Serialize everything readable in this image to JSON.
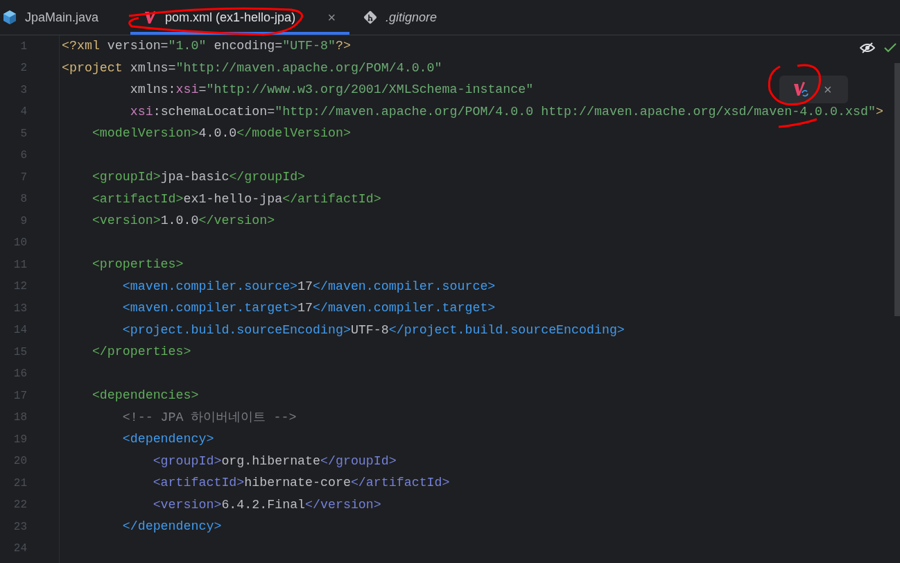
{
  "tabs": [
    {
      "label": "JpaMain.java",
      "kind": "java",
      "selected": false
    },
    {
      "label": "pom.xml (ex1-hello-jpa)",
      "kind": "maven",
      "selected": true,
      "close": "×"
    },
    {
      "label": ".gitignore",
      "kind": "git",
      "selected": false
    }
  ],
  "popup": {
    "close": "×"
  },
  "lines": [
    {
      "number": "1",
      "tokens": [
        {
          "kind": "tag1",
          "t": "<?xml"
        },
        {
          "kind": "attr",
          "t": " version="
        },
        {
          "kind": "str",
          "t": "\"1.0\""
        },
        {
          "kind": "attr",
          "t": " encoding="
        },
        {
          "kind": "str",
          "t": "\"UTF-8\""
        },
        {
          "kind": "tag1",
          "t": "?>"
        }
      ]
    },
    {
      "number": "2",
      "tokens": [
        {
          "kind": "tag1",
          "t": "<project"
        },
        {
          "kind": "attr",
          "t": " xmlns="
        },
        {
          "kind": "str",
          "t": "\"http://maven.apache.org/POM/4.0.0\""
        }
      ]
    },
    {
      "number": "3",
      "tokens": [
        {
          "kind": "attr",
          "t": "         xmlns:"
        },
        {
          "kind": "ns",
          "t": "xsi"
        },
        {
          "kind": "attr",
          "t": "="
        },
        {
          "kind": "str",
          "t": "\"http://www.w3.org/2001/XMLSchema-instance\""
        }
      ]
    },
    {
      "number": "4",
      "tokens": [
        {
          "kind": "ns",
          "t": "         xsi"
        },
        {
          "kind": "attr",
          "t": ":schemaLocation="
        },
        {
          "kind": "str",
          "t": "\"http://maven.apache.org/POM/4.0.0 http://maven.apache.org/xsd/maven-4.0.0.xsd\""
        },
        {
          "kind": "tag1",
          "t": ">"
        }
      ]
    },
    {
      "number": "5",
      "tokens": [
        {
          "kind": "tag2",
          "t": "    <modelVersion>"
        },
        {
          "kind": "text",
          "t": "4.0.0"
        },
        {
          "kind": "tag2",
          "t": "</modelVersion>"
        }
      ]
    },
    {
      "number": "6"
    },
    {
      "number": "7",
      "tokens": [
        {
          "kind": "tag2",
          "t": "    <groupId>"
        },
        {
          "kind": "text",
          "t": "jpa-basic"
        },
        {
          "kind": "tag2",
          "t": "</groupId>"
        }
      ]
    },
    {
      "number": "8",
      "tokens": [
        {
          "kind": "tag2",
          "t": "    <artifactId>"
        },
        {
          "kind": "text",
          "t": "ex1-hello-jpa"
        },
        {
          "kind": "tag2",
          "t": "</artifactId>"
        }
      ]
    },
    {
      "number": "9",
      "tokens": [
        {
          "kind": "tag2",
          "t": "    <version>"
        },
        {
          "kind": "text",
          "t": "1.0.0"
        },
        {
          "kind": "tag2",
          "t": "</version>"
        }
      ]
    },
    {
      "number": "10"
    },
    {
      "number": "11",
      "tokens": [
        {
          "kind": "tag2",
          "t": "    <properties>"
        }
      ]
    },
    {
      "number": "12",
      "tokens": [
        {
          "kind": "tag3",
          "t": "        <maven.compiler.source>"
        },
        {
          "kind": "text",
          "t": "17"
        },
        {
          "kind": "tag3",
          "t": "</maven.compiler.source>"
        }
      ]
    },
    {
      "number": "13",
      "tokens": [
        {
          "kind": "tag3",
          "t": "        <maven.compiler.target>"
        },
        {
          "kind": "text",
          "t": "17"
        },
        {
          "kind": "tag3",
          "t": "</maven.compiler.target>"
        }
      ]
    },
    {
      "number": "14",
      "tokens": [
        {
          "kind": "tag3",
          "t": "        <project.build.sourceEncoding>"
        },
        {
          "kind": "text",
          "t": "UTF-8"
        },
        {
          "kind": "tag3",
          "t": "</project.build.sourceEncoding>"
        }
      ]
    },
    {
      "number": "15",
      "tokens": [
        {
          "kind": "tag2",
          "t": "    </properties>"
        }
      ]
    },
    {
      "number": "16"
    },
    {
      "number": "17",
      "tokens": [
        {
          "kind": "tag2",
          "t": "    <dependencies>"
        }
      ]
    },
    {
      "number": "18",
      "tokens": [
        {
          "kind": "comment",
          "t": "        <!-- JPA 하이버네이트 -->"
        }
      ]
    },
    {
      "number": "19",
      "tokens": [
        {
          "kind": "tag3",
          "t": "        <dependency>"
        }
      ]
    },
    {
      "number": "20",
      "tokens": [
        {
          "kind": "tag4",
          "t": "            <groupId>"
        },
        {
          "kind": "text",
          "t": "org.hibernate"
        },
        {
          "kind": "tag4",
          "t": "</groupId>"
        }
      ]
    },
    {
      "number": "21",
      "tokens": [
        {
          "kind": "tag4",
          "t": "            <artifactId>"
        },
        {
          "kind": "text",
          "t": "hibernate-core"
        },
        {
          "kind": "tag4",
          "t": "</artifactId>"
        }
      ]
    },
    {
      "number": "22",
      "tokens": [
        {
          "kind": "tag4",
          "t": "            <version>"
        },
        {
          "kind": "text",
          "t": "6.4.2.Final"
        },
        {
          "kind": "tag4",
          "t": "</version>"
        }
      ]
    },
    {
      "number": "23",
      "tokens": [
        {
          "kind": "tag3",
          "t": "        </dependency>"
        }
      ]
    },
    {
      "number": "24"
    }
  ]
}
